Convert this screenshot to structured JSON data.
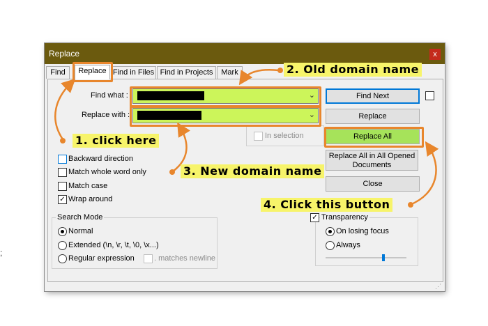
{
  "editor": {
    "fragment": ";"
  },
  "dialog": {
    "title": "Replace",
    "close": "x",
    "tabs": [
      "Find",
      "Replace",
      "Find in Files",
      "Find in Projects",
      "Mark"
    ],
    "labels": {
      "find_what": "Find what :",
      "replace_with": "Replace with :",
      "in_selection": "In selection"
    },
    "buttons": {
      "find_next": "Find Next",
      "replace": "Replace",
      "replace_all": "Replace All",
      "replace_all_opened": "Replace All in All Opened Documents",
      "close": "Close"
    },
    "options": {
      "backward": "Backward direction",
      "whole_word": "Match whole word only",
      "match_case": "Match case",
      "wrap_around": "Wrap around"
    },
    "search_mode": {
      "title": "Search Mode",
      "normal": "Normal",
      "extended": "Extended (\\n, \\r, \\t, \\0, \\x...)",
      "regex": "Regular expression",
      "matches_newline": ". matches newline"
    },
    "transparency": {
      "label": "Transparency",
      "on_losing_focus": "On losing focus",
      "always": "Always",
      "slider_level": 0.72
    }
  },
  "callouts": {
    "step1": "1. click here",
    "step2": "2. Old domain name",
    "step3": "3. New domain name",
    "step4": "4. Click this button"
  },
  "colors": {
    "title_bar": "#6b5a0e",
    "highlight": "#e8862c",
    "callout_bg": "#f7f46a",
    "field_bg": "#ccf55a",
    "button_green": "#a6e35a"
  }
}
